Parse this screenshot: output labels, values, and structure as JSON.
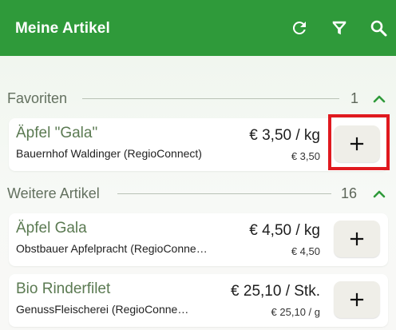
{
  "appbar": {
    "title": "Meine Artikel",
    "actions": [
      "refresh-icon",
      "filter-icon",
      "search-icon"
    ],
    "background": "#2f9a3a"
  },
  "sections": [
    {
      "label": "Favoriten",
      "count": "1",
      "items": [
        {
          "name": "Äpfel \"Gala\"",
          "vendor": "Bauernhof Waldinger (RegioConnect)",
          "price": "€ 3,50 / kg",
          "unit_price": "€ 3,50"
        }
      ]
    },
    {
      "label": "Weitere Artikel",
      "count": "16",
      "items": [
        {
          "name": "Äpfel Gala",
          "vendor": "Obstbauer Apfelpracht (RegioConne…",
          "price": "€ 4,50 / kg",
          "unit_price": "€ 4,50"
        },
        {
          "name": "Bio Rinderfilet",
          "vendor": "GenussFleischerei (RegioConne…",
          "price": "€ 25,10 / Stk.",
          "unit_price": "€ 25,10 / g"
        }
      ]
    }
  ],
  "accent_color": "#2f9a3a",
  "highlight_color": "#e0191f"
}
